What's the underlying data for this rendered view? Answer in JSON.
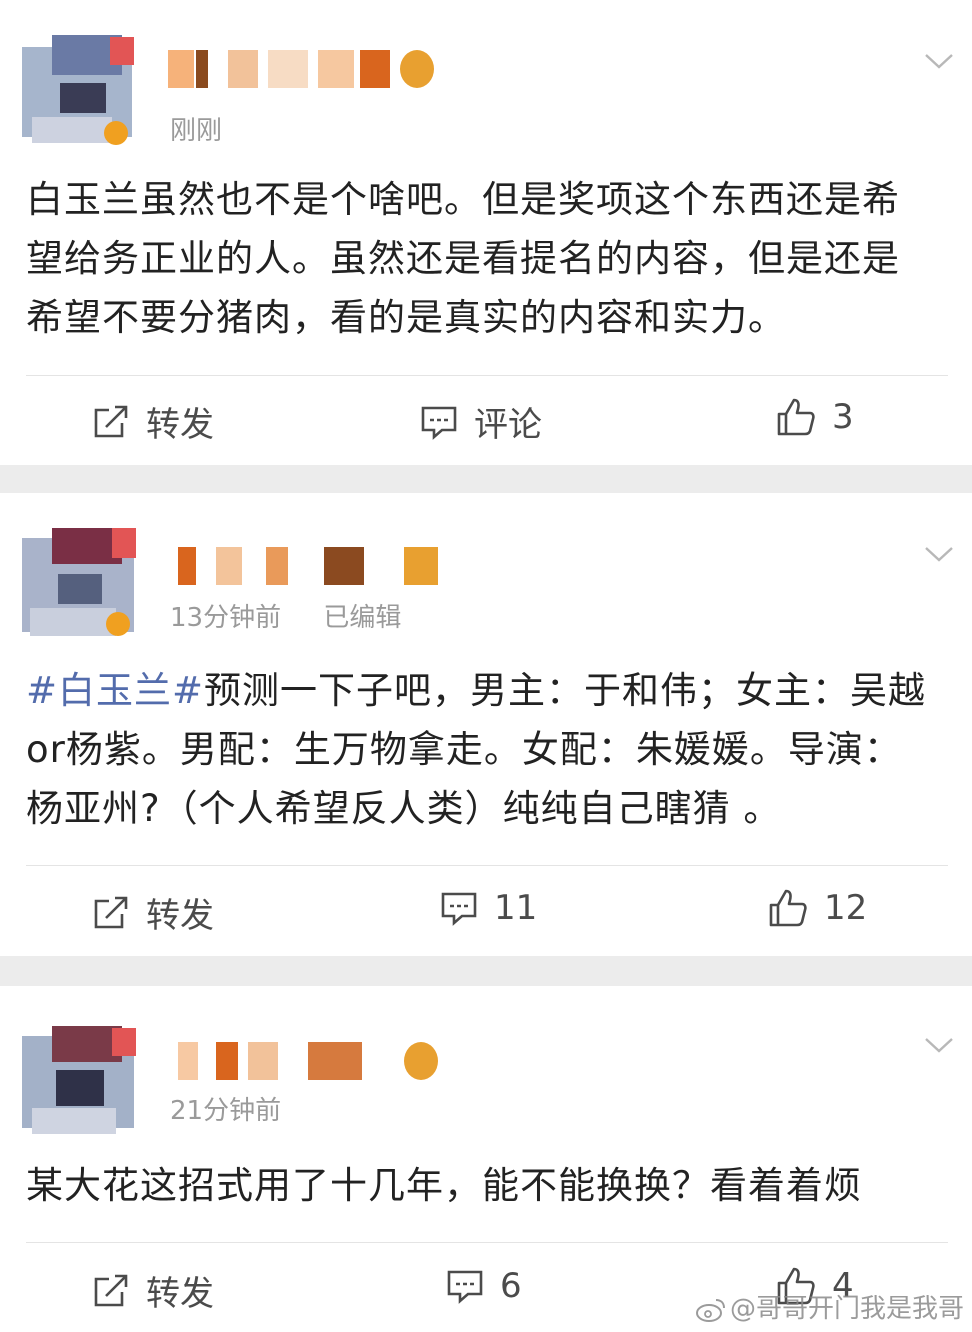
{
  "posts": [
    {
      "time": "刚刚",
      "edited": "",
      "text": "白玉兰虽然也不是个啥吧。但是奖项这个东西还是希望给务正业的人。虽然还是看提名的内容，但是还是希望不要分猪肉，看的是真实的内容和实力。",
      "tag": "",
      "actions": {
        "repost": "转发",
        "comment": "评论",
        "like": "3"
      }
    },
    {
      "time": "13分钟前",
      "edited": "已编辑",
      "tag": "#白玉兰#",
      "text": "预测一下子吧，男主：于和伟；女主：吴越or杨紫。男配：生万物拿走。女配：朱媛媛。导演：杨亚州?（个人希望反人类）纯纯自己瞎猜 。",
      "actions": {
        "repost": "转发",
        "comment": "11",
        "like": "12"
      }
    },
    {
      "time": "21分钟前",
      "edited": "",
      "tag": "",
      "text": "某大花这招式用了十几年，能不能换换？看着着烦",
      "actions": {
        "repost": "转发",
        "comment": "6",
        "like": "4"
      }
    }
  ],
  "watermark": "@哥哥开门我是我哥",
  "icons": [
    "repost-icon",
    "comment-icon",
    "like-icon",
    "chevron-down-icon",
    "weibo-logo-icon"
  ],
  "colors": {
    "tag": "#536cac",
    "separator": "#ececec",
    "meta": "#9a9a9a"
  }
}
